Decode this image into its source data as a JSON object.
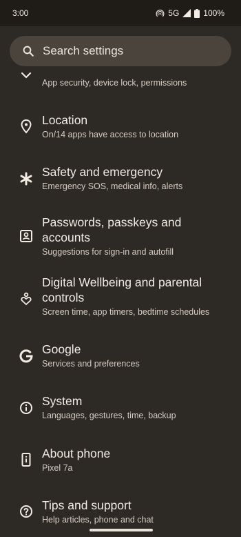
{
  "status_bar": {
    "time": "3:00",
    "network": "5G",
    "battery": "100%"
  },
  "search": {
    "placeholder": "Search settings"
  },
  "settings": [
    {
      "title": "",
      "subtitle": "App security, device lock, permissions",
      "icon": "security-chevron-icon"
    },
    {
      "title": "Location",
      "subtitle": "On/14 apps have access to location",
      "icon": "location-pin-icon"
    },
    {
      "title": "Safety and emergency",
      "subtitle": "Emergency SOS, medical info, alerts",
      "icon": "asterisk-icon"
    },
    {
      "title": "Passwords, passkeys and accounts",
      "subtitle": "Suggestions for sign-in and autofill",
      "icon": "account-box-icon"
    },
    {
      "title": "Digital Wellbeing and parental controls",
      "subtitle": "Screen time, app timers, bedtime schedules",
      "icon": "wellbeing-icon"
    },
    {
      "title": "Google",
      "subtitle": "Services and preferences",
      "icon": "google-g-icon"
    },
    {
      "title": "System",
      "subtitle": "Languages, gestures, time, backup",
      "icon": "info-icon"
    },
    {
      "title": "About phone",
      "subtitle": "Pixel 7a",
      "icon": "phone-info-icon"
    },
    {
      "title": "Tips and support",
      "subtitle": "Help articles, phone and chat",
      "icon": "help-circle-icon"
    }
  ]
}
